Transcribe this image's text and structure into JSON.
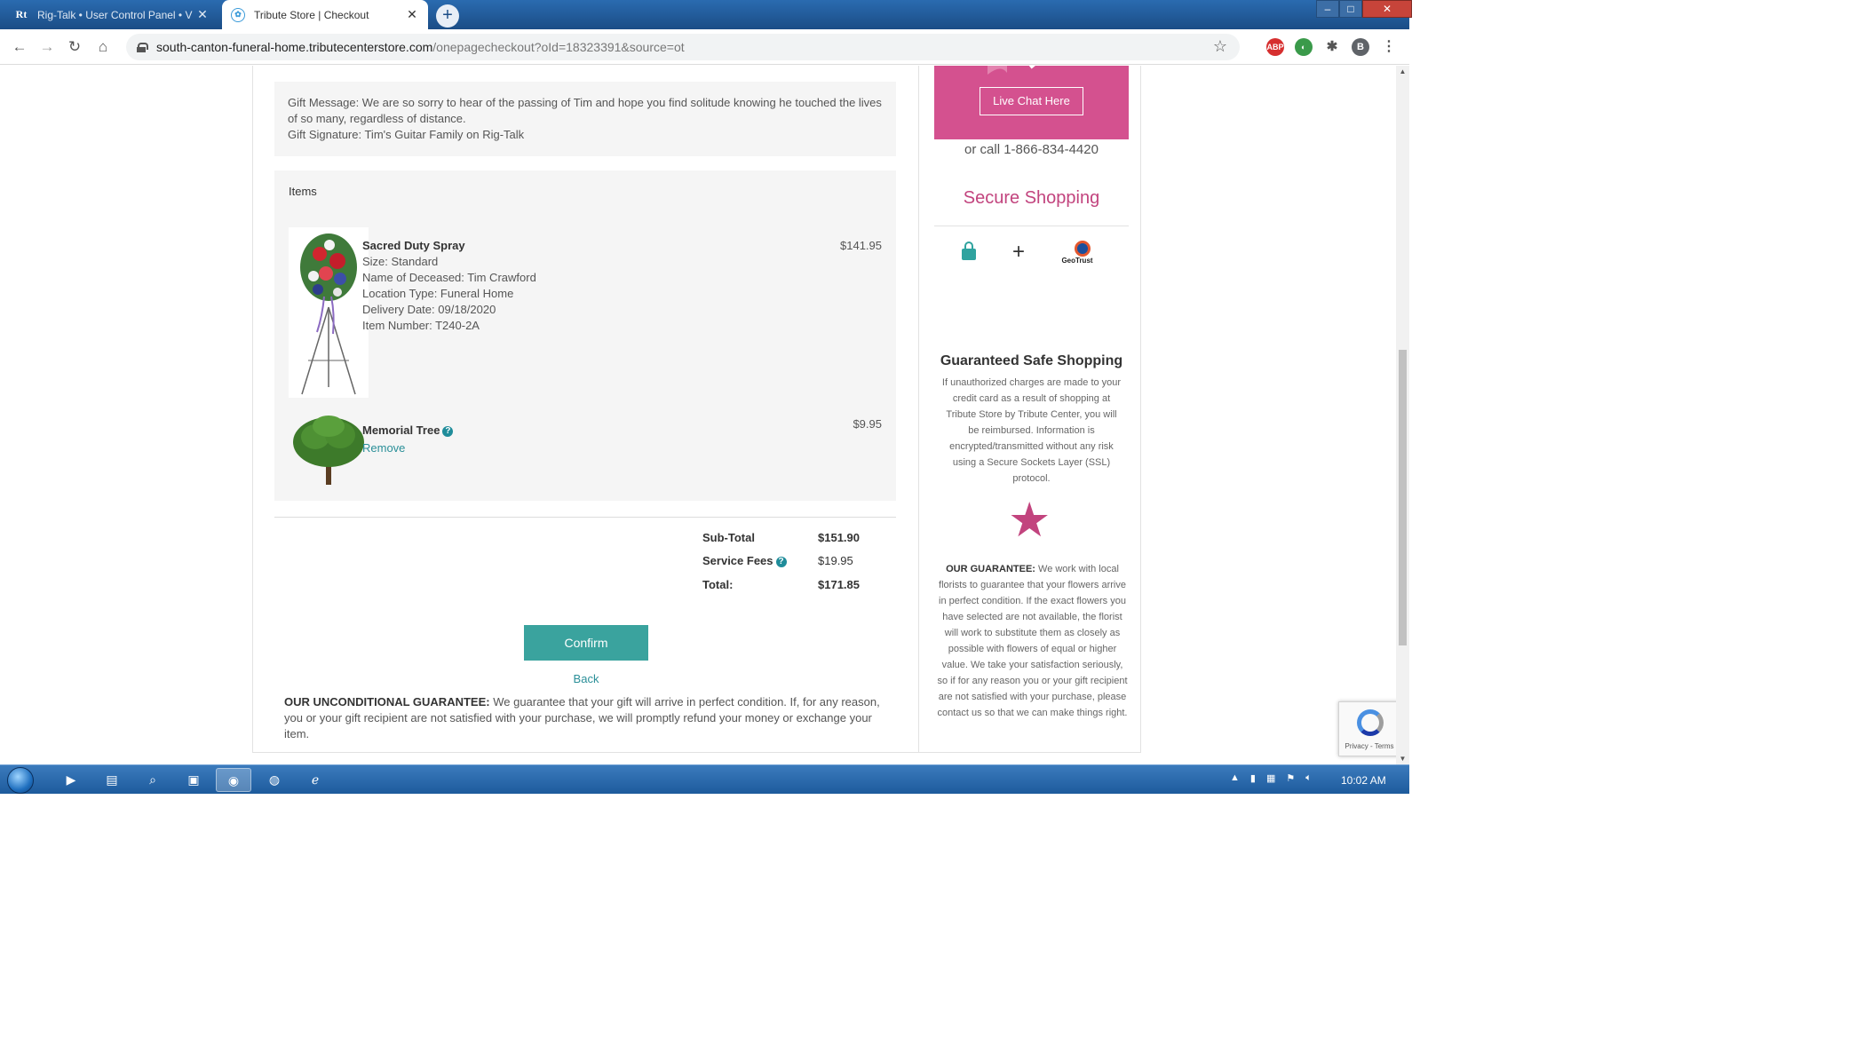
{
  "browser": {
    "tabs": [
      {
        "icon": "Rt",
        "label": "Rig-Talk • User Control Panel • V",
        "active": false
      },
      {
        "icon": "✿",
        "label": "Tribute Store | Checkout",
        "active": true
      }
    ],
    "new_tab": "+",
    "url_host": "south-canton-funeral-home.tributecenterstore.com",
    "url_path": "/onepagecheckout?oId=18323391&source=ot",
    "profile_initial": "B",
    "ext_abp": "ABP"
  },
  "gift": {
    "message": "Gift Message: We are so sorry to hear of the passing of Tim and hope you find solitude knowing he touched the lives of so many, regardless of distance.",
    "signature": "Gift Signature: Tim's Guitar Family on Rig-Talk"
  },
  "items": {
    "title": "Items",
    "list": [
      {
        "name": "Sacred Duty Spray",
        "details": [
          "Size: Standard",
          "Name of Deceased: Tim Crawford",
          "Location Type: Funeral Home",
          "Delivery Date: 09/18/2020",
          "Item Number: T240-2A"
        ],
        "price": "$141.95"
      },
      {
        "name": "Memorial Tree",
        "remove_label": "Remove",
        "price": "$9.95"
      }
    ]
  },
  "totals": {
    "subtotal_label": "Sub-Total",
    "subtotal": "$151.90",
    "service_label": "Service Fees",
    "service": "$19.95",
    "total_label": "Total:",
    "total": "$171.85"
  },
  "actions": {
    "confirm": "Confirm",
    "back": "Back"
  },
  "guarantee": {
    "heading": "OUR UNCONDITIONAL GUARANTEE:",
    "text": " We guarantee that your gift will arrive in perfect condition. If, for any reason, you or your gift recipient are not satisfied with your purchase, we will promptly refund your money or exchange your item."
  },
  "sidebar": {
    "chat_button": "Live Chat Here",
    "call": "or call 1-866-834-4420",
    "secure_title": "Secure Shopping",
    "geotrust": "GeoTrust",
    "safe_title": "Guaranteed Safe Shopping",
    "safe_text": "If unauthorized charges are made to your credit card as a result of shopping at Tribute Store by Tribute Center, you will be reimbursed. Information is encrypted/transmitted without any risk using a Secure Sockets Layer (SSL) protocol.",
    "guarantee_heading": "OUR GUARANTEE:",
    "guarantee_text": " We work with local florists to guarantee that your flowers arrive in perfect condition. If the exact flowers you have selected are not available, the florist will work to substitute them as closely as possible with flowers of equal or higher value. We take your satisfaction seriously, so if for any reason you or your gift recipient are not satisfied with your purchase, please contact us so that we can make things right."
  },
  "recaptcha": {
    "label": "Privacy - Terms"
  },
  "taskbar": {
    "clock": "10:02 AM"
  },
  "colors": {
    "accent_teal": "#3aa39e",
    "brand_pink": "#c2447e",
    "banner_pink": "#d4518f"
  }
}
